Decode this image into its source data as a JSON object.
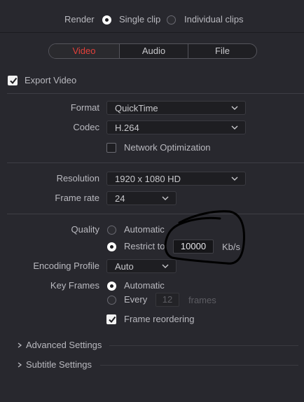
{
  "render": {
    "label": "Render",
    "options": [
      {
        "label": "Single clip",
        "selected": true
      },
      {
        "label": "Individual clips",
        "selected": false
      }
    ]
  },
  "tabs": [
    {
      "label": "Video",
      "active": true
    },
    {
      "label": "Audio",
      "active": false
    },
    {
      "label": "File",
      "active": false
    }
  ],
  "export_video": {
    "label": "Export Video",
    "checked": true
  },
  "format": {
    "label": "Format",
    "value": "QuickTime"
  },
  "codec": {
    "label": "Codec",
    "value": "H.264"
  },
  "network_optimization": {
    "label": "Network Optimization",
    "checked": false
  },
  "resolution": {
    "label": "Resolution",
    "value": "1920 x 1080 HD"
  },
  "frame_rate": {
    "label": "Frame rate",
    "value": "24"
  },
  "quality": {
    "label": "Quality",
    "automatic_label": "Automatic",
    "automatic_selected": false,
    "restrict_label": "Restrict to",
    "restrict_selected": true,
    "restrict_value": "10000",
    "restrict_unit": "Kb/s"
  },
  "encoding_profile": {
    "label": "Encoding Profile",
    "value": "Auto"
  },
  "key_frames": {
    "label": "Key Frames",
    "automatic_label": "Automatic",
    "automatic_selected": true,
    "every_label": "Every",
    "every_selected": false,
    "every_value": "12",
    "every_unit": "frames"
  },
  "frame_reordering": {
    "label": "Frame reordering",
    "checked": true
  },
  "sections": [
    {
      "label": "Advanced Settings",
      "expanded": false
    },
    {
      "label": "Subtitle Settings",
      "expanded": false
    }
  ],
  "colors": {
    "background": "#28282e",
    "active_tab": "#e2403a",
    "annotation": "#000000"
  }
}
